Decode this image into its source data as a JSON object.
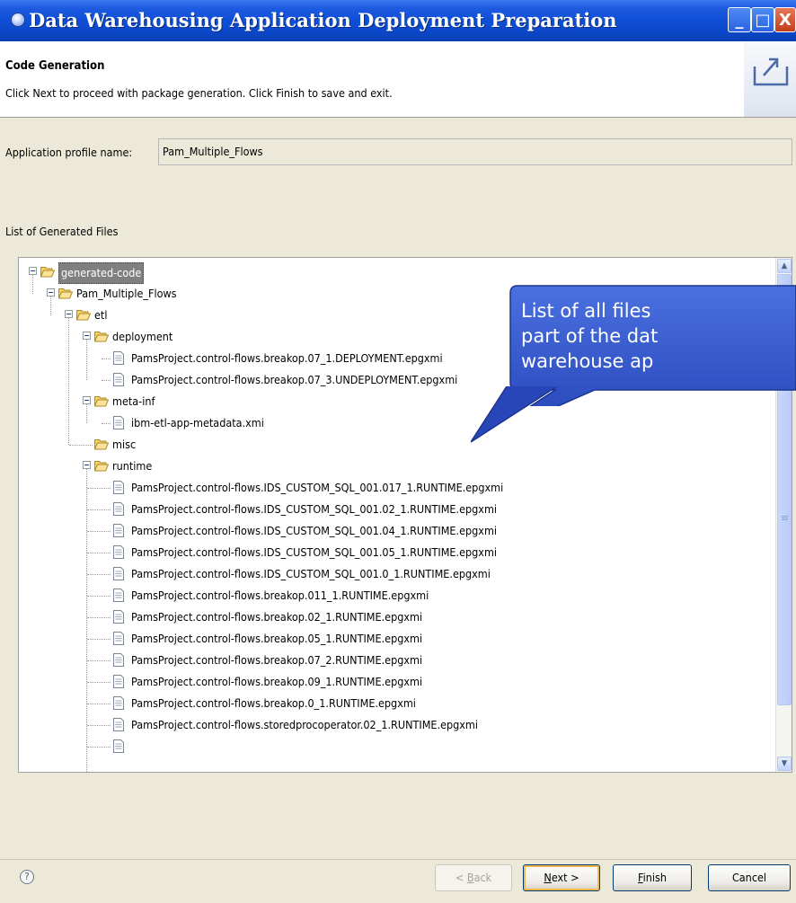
{
  "window": {
    "title": "Data Warehousing Application Deployment Preparation",
    "controls": {
      "minimize": "_",
      "maximize": "□",
      "close": "X"
    }
  },
  "banner": {
    "title": "Code Generation",
    "description": "Click Next to proceed with package generation. Click Finish to save and exit."
  },
  "profile": {
    "label": "Application profile name:",
    "value": "Pam_Multiple_Flows"
  },
  "files": {
    "label": "List of Generated Files"
  },
  "tree": {
    "root": "generated-code",
    "project": "Pam_Multiple_Flows",
    "etl": "etl",
    "deployment": "deployment",
    "deployment_files": [
      "PamsProject.control-flows.breakop.07_1.DEPLOYMENT.epgxmi",
      "PamsProject.control-flows.breakop.07_3.UNDEPLOYMENT.epgxmi"
    ],
    "meta_inf": "meta-inf",
    "meta_inf_files": [
      "ibm-etl-app-metadata.xmi"
    ],
    "misc": "misc",
    "runtime": "runtime",
    "runtime_files": [
      "PamsProject.control-flows.IDS_CUSTOM_SQL_001.017_1.RUNTIME.epgxmi",
      "PamsProject.control-flows.IDS_CUSTOM_SQL_001.02_1.RUNTIME.epgxmi",
      "PamsProject.control-flows.IDS_CUSTOM_SQL_001.04_1.RUNTIME.epgxmi",
      "PamsProject.control-flows.IDS_CUSTOM_SQL_001.05_1.RUNTIME.epgxmi",
      "PamsProject.control-flows.IDS_CUSTOM_SQL_001.0_1.RUNTIME.epgxmi",
      "PamsProject.control-flows.breakop.011_1.RUNTIME.epgxmi",
      "PamsProject.control-flows.breakop.02_1.RUNTIME.epgxmi",
      "PamsProject.control-flows.breakop.05_1.RUNTIME.epgxmi",
      "PamsProject.control-flows.breakop.07_2.RUNTIME.epgxmi",
      "PamsProject.control-flows.breakop.09_1.RUNTIME.epgxmi",
      "PamsProject.control-flows.breakop.0_1.RUNTIME.epgxmi",
      "PamsProject.control-flows.storedprocoperator.02_1.RUNTIME.epgxmi"
    ]
  },
  "callout": {
    "lines": [
      "List of all files",
      "part of the dat",
      "warehouse ap"
    ]
  },
  "buttons": {
    "help": "?",
    "back_prefix": "< ",
    "back_key": "B",
    "back_rest": "ack",
    "next_key": "N",
    "next_rest": "ext >",
    "finish_key": "F",
    "finish_rest": "inish",
    "cancel": "Cancel"
  },
  "colors": {
    "titlebar": "#0f4fd7",
    "dialog_bg": "#ece9d8",
    "callout": "#2f52c8",
    "selection": "#808080"
  }
}
